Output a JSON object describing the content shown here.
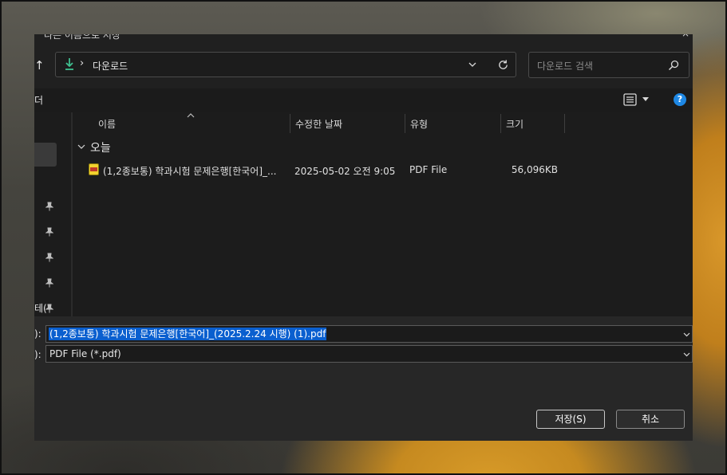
{
  "window": {
    "title": "다른 이름으로 저장",
    "close_glyph": "×"
  },
  "toolbar": {
    "up_glyph": "↑",
    "address": {
      "separator": "›",
      "path": "다운로드"
    },
    "search_placeholder": "다운로드 검색"
  },
  "commandbar": {
    "new_folder_cut": "더",
    "help_label": "?"
  },
  "navpane": {
    "cut_label": "테("
  },
  "columns": [
    {
      "label": "이름"
    },
    {
      "label": "수정한 날짜"
    },
    {
      "label": "유형"
    },
    {
      "label": "크기"
    }
  ],
  "group": {
    "label": "오늘"
  },
  "files": [
    {
      "icon": "pdf-icon",
      "name": "(1,2종보통) 학과시험 문제은행[한국어]_...",
      "date": "2025-05-02 오전 9:05",
      "type": "PDF File",
      "size": "56,096KB"
    }
  ],
  "form": {
    "filename_label": "):",
    "filename_value": "(1,2종보통) 학과시험 문제은행[한국어]_(2025.2.24 시행) (1).pdf",
    "filetype_label": "):",
    "filetype_value": "PDF File (*.pdf)"
  },
  "buttons": {
    "save": "저장(S)",
    "cancel": "취소"
  },
  "colors": {
    "accent": "#0a5fcf",
    "download_icon": "#3fbf8f",
    "help": "#1e88e5"
  }
}
